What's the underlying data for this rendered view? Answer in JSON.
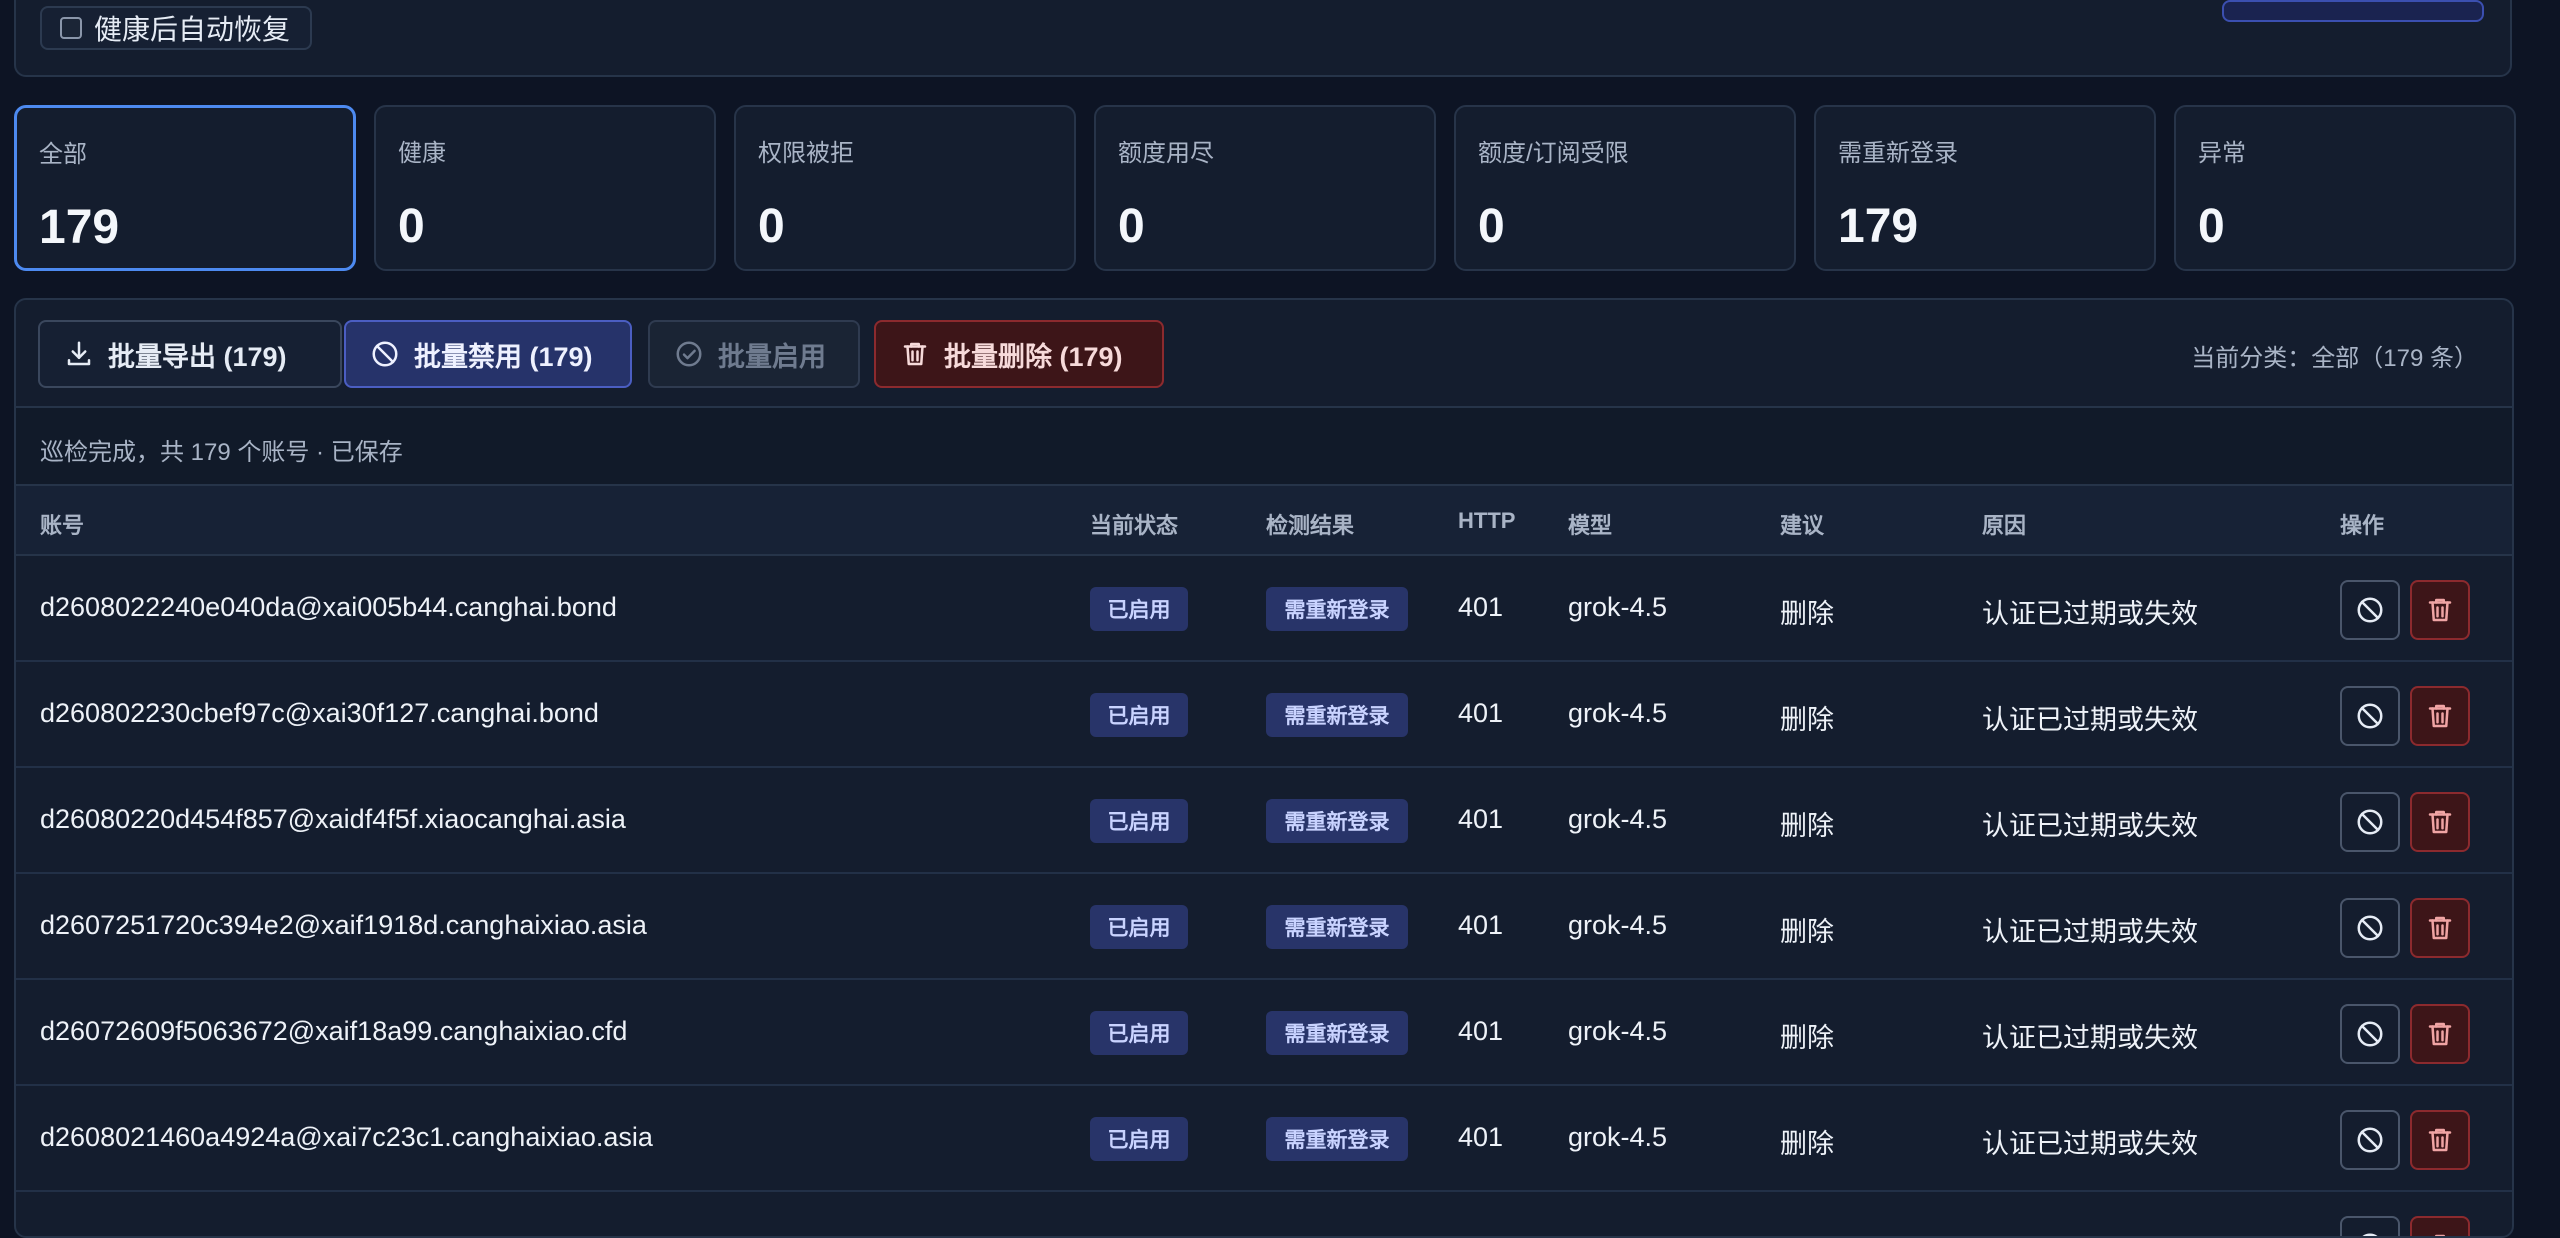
{
  "top": {
    "auto_recover_label": "健康后自动恢复"
  },
  "stats": [
    {
      "label": "全部",
      "value": "179",
      "active": true
    },
    {
      "label": "健康",
      "value": "0"
    },
    {
      "label": "权限被拒",
      "value": "0"
    },
    {
      "label": "额度用尽",
      "value": "0"
    },
    {
      "label": "额度/订阅受限",
      "value": "0"
    },
    {
      "label": "需重新登录",
      "value": "179"
    },
    {
      "label": "异常",
      "value": "0"
    }
  ],
  "toolbar": {
    "export_label": "批量导出 (179)",
    "disable_label": "批量禁用 (179)",
    "enable_label": "批量启用",
    "delete_label": "批量删除 (179)",
    "current_category": "当前分类：全部（179 条）"
  },
  "notice": "巡检完成，共 179 个账号 · 已保存",
  "table": {
    "headers": {
      "account": "账号",
      "status": "当前状态",
      "result": "检测结果",
      "http": "HTTP",
      "model": "模型",
      "suggestion": "建议",
      "reason": "原因",
      "actions": "操作"
    },
    "rows": [
      {
        "account": "d2608022240e040da@xai005b44.canghai.bond",
        "status": "已启用",
        "result": "需重新登录",
        "http": "401",
        "model": "grok-4.5",
        "suggestion": "删除",
        "reason": "认证已过期或失效"
      },
      {
        "account": "d260802230cbef97c@xai30f127.canghai.bond",
        "status": "已启用",
        "result": "需重新登录",
        "http": "401",
        "model": "grok-4.5",
        "suggestion": "删除",
        "reason": "认证已过期或失效"
      },
      {
        "account": "d26080220d454f857@xaidf4f5f.xiaocanghai.asia",
        "status": "已启用",
        "result": "需重新登录",
        "http": "401",
        "model": "grok-4.5",
        "suggestion": "删除",
        "reason": "认证已过期或失效"
      },
      {
        "account": "d2607251720c394e2@xaif1918d.canghaixiao.asia",
        "status": "已启用",
        "result": "需重新登录",
        "http": "401",
        "model": "grok-4.5",
        "suggestion": "删除",
        "reason": "认证已过期或失效"
      },
      {
        "account": "d26072609f5063672@xaif18a99.canghaixiao.cfd",
        "status": "已启用",
        "result": "需重新登录",
        "http": "401",
        "model": "grok-4.5",
        "suggestion": "删除",
        "reason": "认证已过期或失效"
      },
      {
        "account": "d2608021460a4924a@xai7c23c1.canghaixiao.asia",
        "status": "已启用",
        "result": "需重新登录",
        "http": "401",
        "model": "grok-4.5",
        "suggestion": "删除",
        "reason": "认证已过期或失效"
      },
      {
        "account": "",
        "status": "",
        "result": "",
        "http": "",
        "model": "",
        "suggestion": "",
        "reason": ""
      }
    ]
  },
  "icons": {
    "export": "download-icon",
    "disable": "ban-icon",
    "enable": "check-circle-icon",
    "delete": "trash-icon"
  },
  "colors": {
    "accent": "#4d8af0",
    "badge_bg": "#283469",
    "danger": "#8c2a2e"
  }
}
